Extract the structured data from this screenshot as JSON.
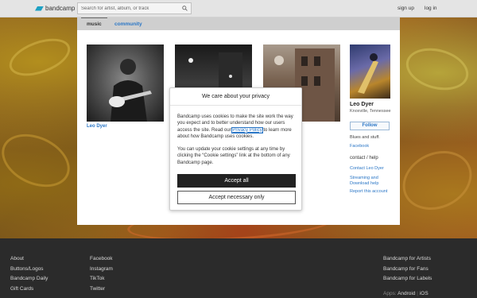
{
  "header": {
    "logo_text": "bandcamp",
    "search_placeholder": "Search for artist, album, or track",
    "signup_label": "sign up",
    "login_label": "log in"
  },
  "tabs": [
    {
      "label": "music",
      "active": true
    },
    {
      "label": "community",
      "active": false
    }
  ],
  "albums": [
    {
      "title": "Leo Dyer"
    },
    {
      "title": ""
    },
    {
      "title": ""
    }
  ],
  "artist": {
    "name": "Leo Dyer",
    "location": "Knoxville, Tennessee",
    "follow_label": "Follow",
    "bio": "Blues and stuff.",
    "facebook_label": "Facebook",
    "contact_heading": "contact / help",
    "contact_link": "Contact Leo Dyer",
    "streaming_link": "Streaming and Download help",
    "report_link": "Report this account"
  },
  "cookie_modal": {
    "title": "We care about your privacy",
    "para1_before": "Bandcamp uses cookies to make the site work the way you expect and to better understand how our users access the site. Read our ",
    "policy_link": "Privacy Policy",
    "para1_after": " to learn more about how Bandcamp uses cookies.",
    "para2": "You can update your cookie settings at any time by clicking the “Cookie settings” link at the bottom of any Bandcamp page.",
    "accept_all_label": "Accept all",
    "accept_necessary_label": "Accept necessary only"
  },
  "footer": {
    "col1": [
      "About",
      "Buttons/Logos",
      "Bandcamp Daily",
      "Gift Cards"
    ],
    "col2": [
      "Facebook",
      "Instagram",
      "TikTok",
      "Twitter"
    ],
    "col3": [
      "Bandcamp for Artists",
      "Bandcamp for Fans",
      "Bandcamp for Labels"
    ],
    "apps_label": "Apps:",
    "apps": [
      "Android",
      "iOS"
    ]
  },
  "colors": {
    "accent_link": "#2a76c6",
    "logo_blue": "#1da0c3",
    "accept_button": "#222222"
  }
}
